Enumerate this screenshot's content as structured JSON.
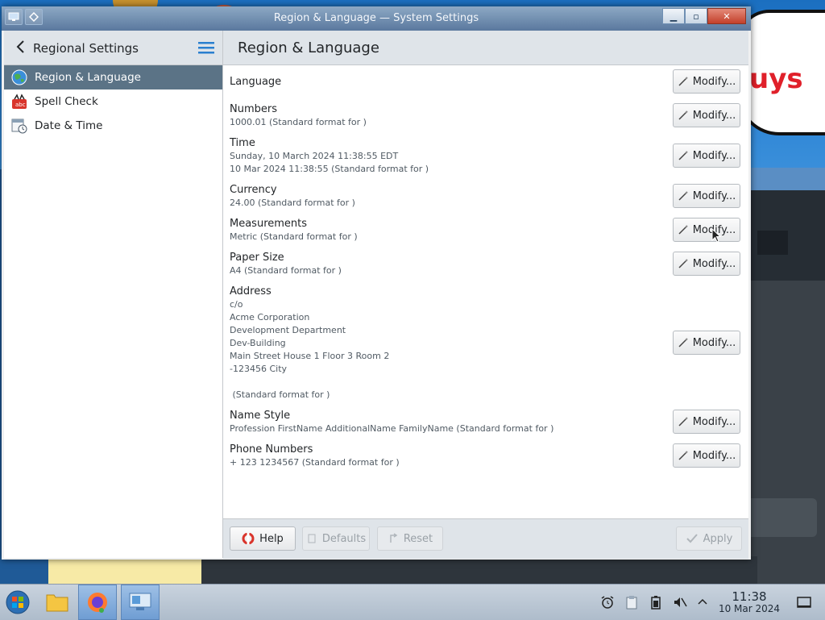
{
  "window": {
    "title": "Region & Language — System Settings",
    "controls": {
      "minimize": "▁",
      "maximize": "▫",
      "close": "✕"
    }
  },
  "sidebar": {
    "title": "Regional Settings",
    "items": [
      {
        "label": "Region & Language",
        "icon": "globe-icon",
        "active": true
      },
      {
        "label": "Spell Check",
        "icon": "spellcheck-icon",
        "active": false
      },
      {
        "label": "Date & Time",
        "icon": "calendar-clock-icon",
        "active": false
      }
    ]
  },
  "main": {
    "title": "Region & Language",
    "settings": [
      {
        "title": "Language",
        "detail": ""
      },
      {
        "title": "Numbers",
        "detail": "1000.01 (Standard format for )"
      },
      {
        "title": "Time",
        "detail": "Sunday, 10 March 2024 11:38:55 EDT\n10 Mar 2024 11:38:55 (Standard format for )"
      },
      {
        "title": "Currency",
        "detail": "24.00 (Standard format for )"
      },
      {
        "title": "Measurements",
        "detail": "Metric (Standard format for )"
      },
      {
        "title": "Paper Size",
        "detail": "A4 (Standard format for )"
      },
      {
        "title": "Address",
        "detail": "c/o\nAcme Corporation\nDevelopment Department\nDev-Building\nMain Street House 1 Floor 3 Room 2\n-123456 City\n\n (Standard format for )"
      },
      {
        "title": "Name Style",
        "detail": "Profession FirstName AdditionalName FamilyName (Standard format for )"
      },
      {
        "title": "Phone Numbers",
        "detail": "+ 123 1234567 (Standard format for )"
      }
    ],
    "modify_label": "Modify...",
    "footer": {
      "help": "Help",
      "defaults": "Defaults",
      "reset": "Reset",
      "apply": "Apply"
    }
  },
  "background": {
    "partial_text": "uys"
  },
  "taskbar": {
    "items": [
      "start-menu",
      "file-manager",
      "firefox",
      "system-settings"
    ],
    "clock_time": "11:38",
    "clock_date": "10 Mar 2024"
  },
  "colors": {
    "accent": "#5b7386",
    "header_bg": "#dfe4e9",
    "help_icon": "#d9342b"
  }
}
